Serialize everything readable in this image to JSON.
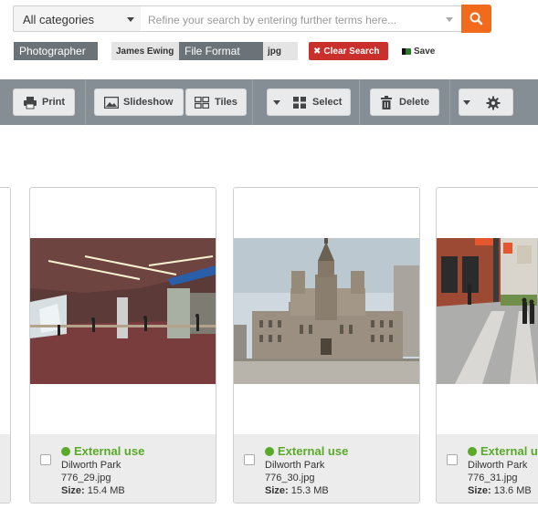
{
  "search": {
    "category_value": "All categories",
    "placeholder": "Refine your search by entering further terms here..."
  },
  "filters": [
    {
      "key": "Photographer",
      "value": "James Ewing"
    },
    {
      "key": "File Format",
      "value": "jpg"
    }
  ],
  "actions": {
    "clear_search": "Clear Search",
    "save": "Save"
  },
  "toolbar": {
    "print": "Print",
    "slideshow": "Slideshow",
    "tiles": "Tiles",
    "select": "Select",
    "delete": "Delete"
  },
  "size_label": "Size:",
  "assets": [
    {
      "status": "External use",
      "location": "Dilworth Park",
      "filename": "776_29.jpg",
      "size": "15.4 MB",
      "image": "subway concourse interior"
    },
    {
      "status": "External use",
      "location": "Dilworth Park",
      "filename": "776_30.jpg",
      "size": "15.3 MB",
      "image": "city hall building"
    },
    {
      "status": "External use",
      "location": "Dilworth Park",
      "filename": "776_31.jpg",
      "size": "13.6 MB",
      "image": "plaza with pedestrians"
    }
  ],
  "colors": {
    "accent": "#f26a1b",
    "toolbar": "#858e94",
    "danger": "#c9302c",
    "status": "#5aaa2a"
  }
}
